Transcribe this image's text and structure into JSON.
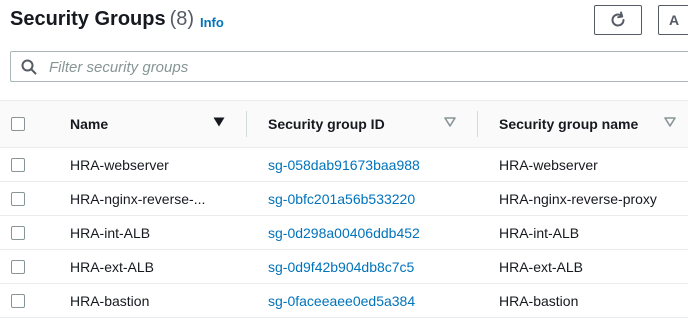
{
  "header": {
    "title": "Security Groups",
    "count": "(8)",
    "info_link": "Info",
    "action_button_label": "A"
  },
  "search": {
    "placeholder": "Filter security groups",
    "value": ""
  },
  "table": {
    "columns": [
      {
        "label": "Name",
        "sort": "sorted-descending"
      },
      {
        "label": "Security group ID",
        "sort": "sortable"
      },
      {
        "label": "Security group name",
        "sort": "sortable"
      }
    ],
    "rows": [
      {
        "name": "HRA-webserver",
        "id": "sg-058dab91673baa988",
        "group_name": "HRA-webserver"
      },
      {
        "name": "HRA-nginx-reverse-...",
        "id": "sg-0bfc201a56b533220",
        "group_name": "HRA-nginx-reverse-proxy"
      },
      {
        "name": "HRA-int-ALB",
        "id": "sg-0d298a00406ddb452",
        "group_name": "HRA-int-ALB"
      },
      {
        "name": "HRA-ext-ALB",
        "id": "sg-0d9f42b904db8c7c5",
        "group_name": "HRA-ext-ALB"
      },
      {
        "name": "HRA-bastion",
        "id": "sg-0faceeaee0ed5a384",
        "group_name": "HRA-bastion"
      }
    ]
  },
  "colors": {
    "link": "#0073bb",
    "text": "#16191f",
    "border": "#eaeded",
    "placeholder": "#879596"
  },
  "icons": {
    "refresh": "refresh-icon",
    "search": "search-icon",
    "sort_desc": "caret-down-filled-icon",
    "sort_none": "caret-down-outline-icon"
  }
}
